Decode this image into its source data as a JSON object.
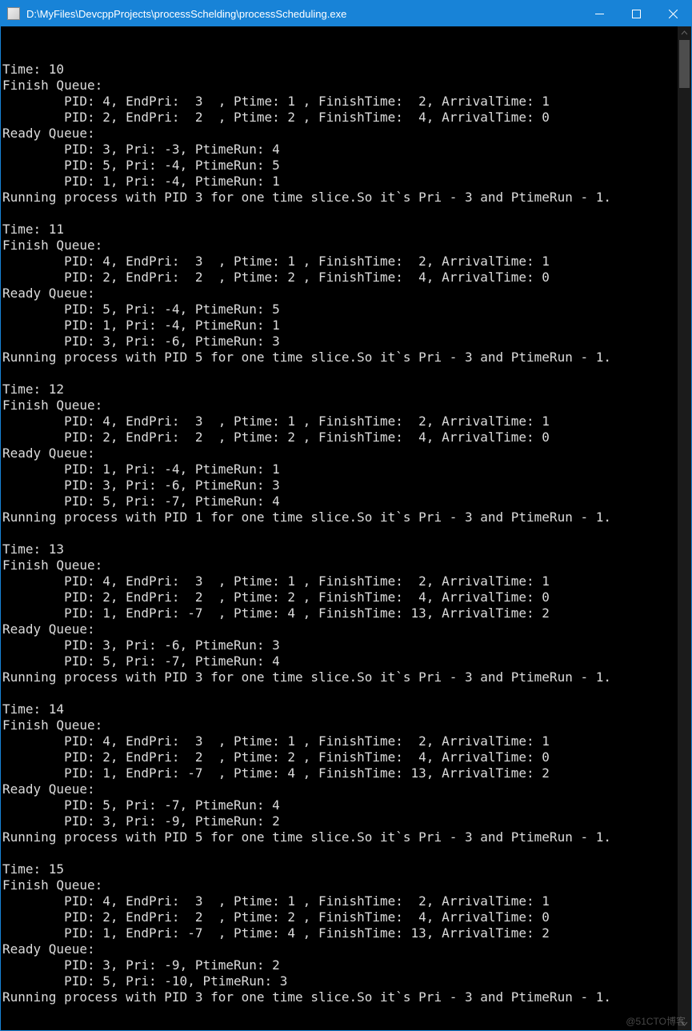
{
  "window": {
    "title": "D:\\MyFiles\\DevcppProjects\\processSchelding\\processScheduling.exe"
  },
  "watermark": "@51CTO博客",
  "blocks": [
    {
      "time": 10,
      "finish": [
        {
          "pid": 4,
          "endPri": 3,
          "ptime": 1,
          "finishTime": 2,
          "arrivalTime": 1
        },
        {
          "pid": 2,
          "endPri": 2,
          "ptime": 2,
          "finishTime": 4,
          "arrivalTime": 0
        }
      ],
      "ready": [
        {
          "pid": 3,
          "pri": -3,
          "ptimeRun": 4
        },
        {
          "pid": 5,
          "pri": -4,
          "ptimeRun": 5
        },
        {
          "pid": 1,
          "pri": -4,
          "ptimeRun": 1
        }
      ],
      "running": {
        "pid": 3,
        "priDelta": -3,
        "ptimeRunDelta": -1
      }
    },
    {
      "time": 11,
      "finish": [
        {
          "pid": 4,
          "endPri": 3,
          "ptime": 1,
          "finishTime": 2,
          "arrivalTime": 1
        },
        {
          "pid": 2,
          "endPri": 2,
          "ptime": 2,
          "finishTime": 4,
          "arrivalTime": 0
        }
      ],
      "ready": [
        {
          "pid": 5,
          "pri": -4,
          "ptimeRun": 5
        },
        {
          "pid": 1,
          "pri": -4,
          "ptimeRun": 1
        },
        {
          "pid": 3,
          "pri": -6,
          "ptimeRun": 3
        }
      ],
      "running": {
        "pid": 5,
        "priDelta": -3,
        "ptimeRunDelta": -1
      }
    },
    {
      "time": 12,
      "finish": [
        {
          "pid": 4,
          "endPri": 3,
          "ptime": 1,
          "finishTime": 2,
          "arrivalTime": 1
        },
        {
          "pid": 2,
          "endPri": 2,
          "ptime": 2,
          "finishTime": 4,
          "arrivalTime": 0
        }
      ],
      "ready": [
        {
          "pid": 1,
          "pri": -4,
          "ptimeRun": 1
        },
        {
          "pid": 3,
          "pri": -6,
          "ptimeRun": 3
        },
        {
          "pid": 5,
          "pri": -7,
          "ptimeRun": 4
        }
      ],
      "running": {
        "pid": 1,
        "priDelta": -3,
        "ptimeRunDelta": -1
      }
    },
    {
      "time": 13,
      "finish": [
        {
          "pid": 4,
          "endPri": 3,
          "ptime": 1,
          "finishTime": 2,
          "arrivalTime": 1
        },
        {
          "pid": 2,
          "endPri": 2,
          "ptime": 2,
          "finishTime": 4,
          "arrivalTime": 0
        },
        {
          "pid": 1,
          "endPri": -7,
          "ptime": 4,
          "finishTime": 13,
          "arrivalTime": 2
        }
      ],
      "ready": [
        {
          "pid": 3,
          "pri": -6,
          "ptimeRun": 3
        },
        {
          "pid": 5,
          "pri": -7,
          "ptimeRun": 4
        }
      ],
      "running": {
        "pid": 3,
        "priDelta": -3,
        "ptimeRunDelta": -1
      }
    },
    {
      "time": 14,
      "finish": [
        {
          "pid": 4,
          "endPri": 3,
          "ptime": 1,
          "finishTime": 2,
          "arrivalTime": 1
        },
        {
          "pid": 2,
          "endPri": 2,
          "ptime": 2,
          "finishTime": 4,
          "arrivalTime": 0
        },
        {
          "pid": 1,
          "endPri": -7,
          "ptime": 4,
          "finishTime": 13,
          "arrivalTime": 2
        }
      ],
      "ready": [
        {
          "pid": 5,
          "pri": -7,
          "ptimeRun": 4
        },
        {
          "pid": 3,
          "pri": -9,
          "ptimeRun": 2
        }
      ],
      "running": {
        "pid": 5,
        "priDelta": -3,
        "ptimeRunDelta": -1
      }
    },
    {
      "time": 15,
      "finish": [
        {
          "pid": 4,
          "endPri": 3,
          "ptime": 1,
          "finishTime": 2,
          "arrivalTime": 1
        },
        {
          "pid": 2,
          "endPri": 2,
          "ptime": 2,
          "finishTime": 4,
          "arrivalTime": 0
        },
        {
          "pid": 1,
          "endPri": -7,
          "ptime": 4,
          "finishTime": 13,
          "arrivalTime": 2
        }
      ],
      "ready": [
        {
          "pid": 3,
          "pri": -9,
          "ptimeRun": 2
        },
        {
          "pid": 5,
          "pri": -10,
          "ptimeRun": 3
        }
      ],
      "running": {
        "pid": 3,
        "priDelta": -3,
        "ptimeRunDelta": -1
      }
    }
  ]
}
